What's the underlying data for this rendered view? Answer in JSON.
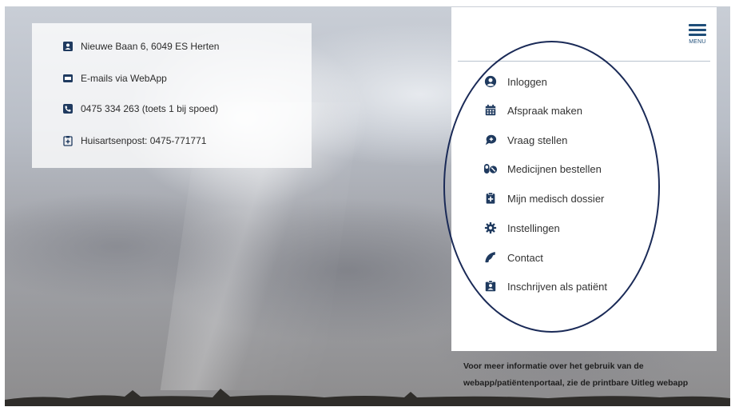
{
  "contact": {
    "address": "Nieuwe Baan 6, 6049 ES Herten",
    "email": "E-mails via WebApp",
    "phone": "0475 334 263 (toets 1 bij spoed)",
    "afterhours": "Huisartsenpost: 0475-771771"
  },
  "menu": {
    "label": "MENU",
    "items": [
      {
        "label": "Inloggen",
        "icon": "user-circle-icon"
      },
      {
        "label": "Afspraak maken",
        "icon": "calendar-icon"
      },
      {
        "label": "Vraag stellen",
        "icon": "chat-bubble-icon"
      },
      {
        "label": "Medicijnen bestellen",
        "icon": "pills-icon"
      },
      {
        "label": "Mijn medisch dossier",
        "icon": "medical-file-icon"
      },
      {
        "label": "Instellingen",
        "icon": "gear-icon"
      },
      {
        "label": "Contact",
        "icon": "phone-icon"
      },
      {
        "label": "Inschrijven als patiënt",
        "icon": "id-badge-icon"
      }
    ]
  },
  "footer": {
    "line1": "Voor meer informatie over het gebruik van de",
    "line2": "webapp/patiëntenportaal, zie de printbare Uitleg webapp"
  },
  "colors": {
    "icon_navy": "#1f3a5f",
    "menu_accent": "#1f4e79",
    "annotation_oval": "#1a2a57"
  }
}
